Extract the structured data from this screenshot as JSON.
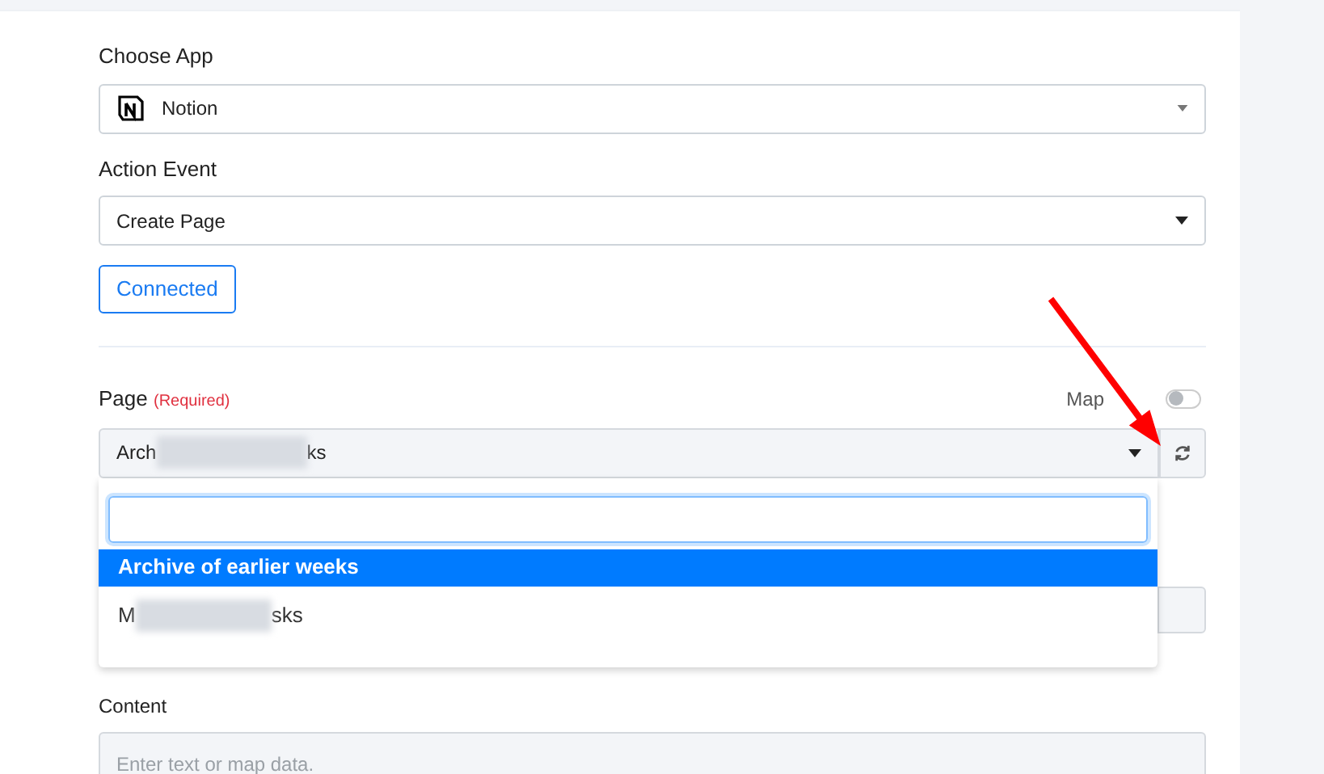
{
  "fields": [
    {
      "kind": "app-select",
      "label": "Choose App",
      "value": "Notion"
    },
    {
      "kind": "select",
      "label": "Action Event",
      "value": "Create Page"
    }
  ],
  "connect_button": {
    "label": "Connected"
  },
  "page_field": {
    "label": "Page",
    "required_note": "(Required)",
    "toggle": {
      "label": "Map",
      "on": false
    },
    "value_start": "Arch",
    "value_end": "ks",
    "options": [
      {
        "label": "Archive of earlier weeks",
        "selected": true
      },
      {
        "label_start": "M",
        "label_end": "sks",
        "selected": false
      }
    ]
  },
  "content_field": {
    "label": "Content",
    "placeholder": "Enter text or map data."
  }
}
